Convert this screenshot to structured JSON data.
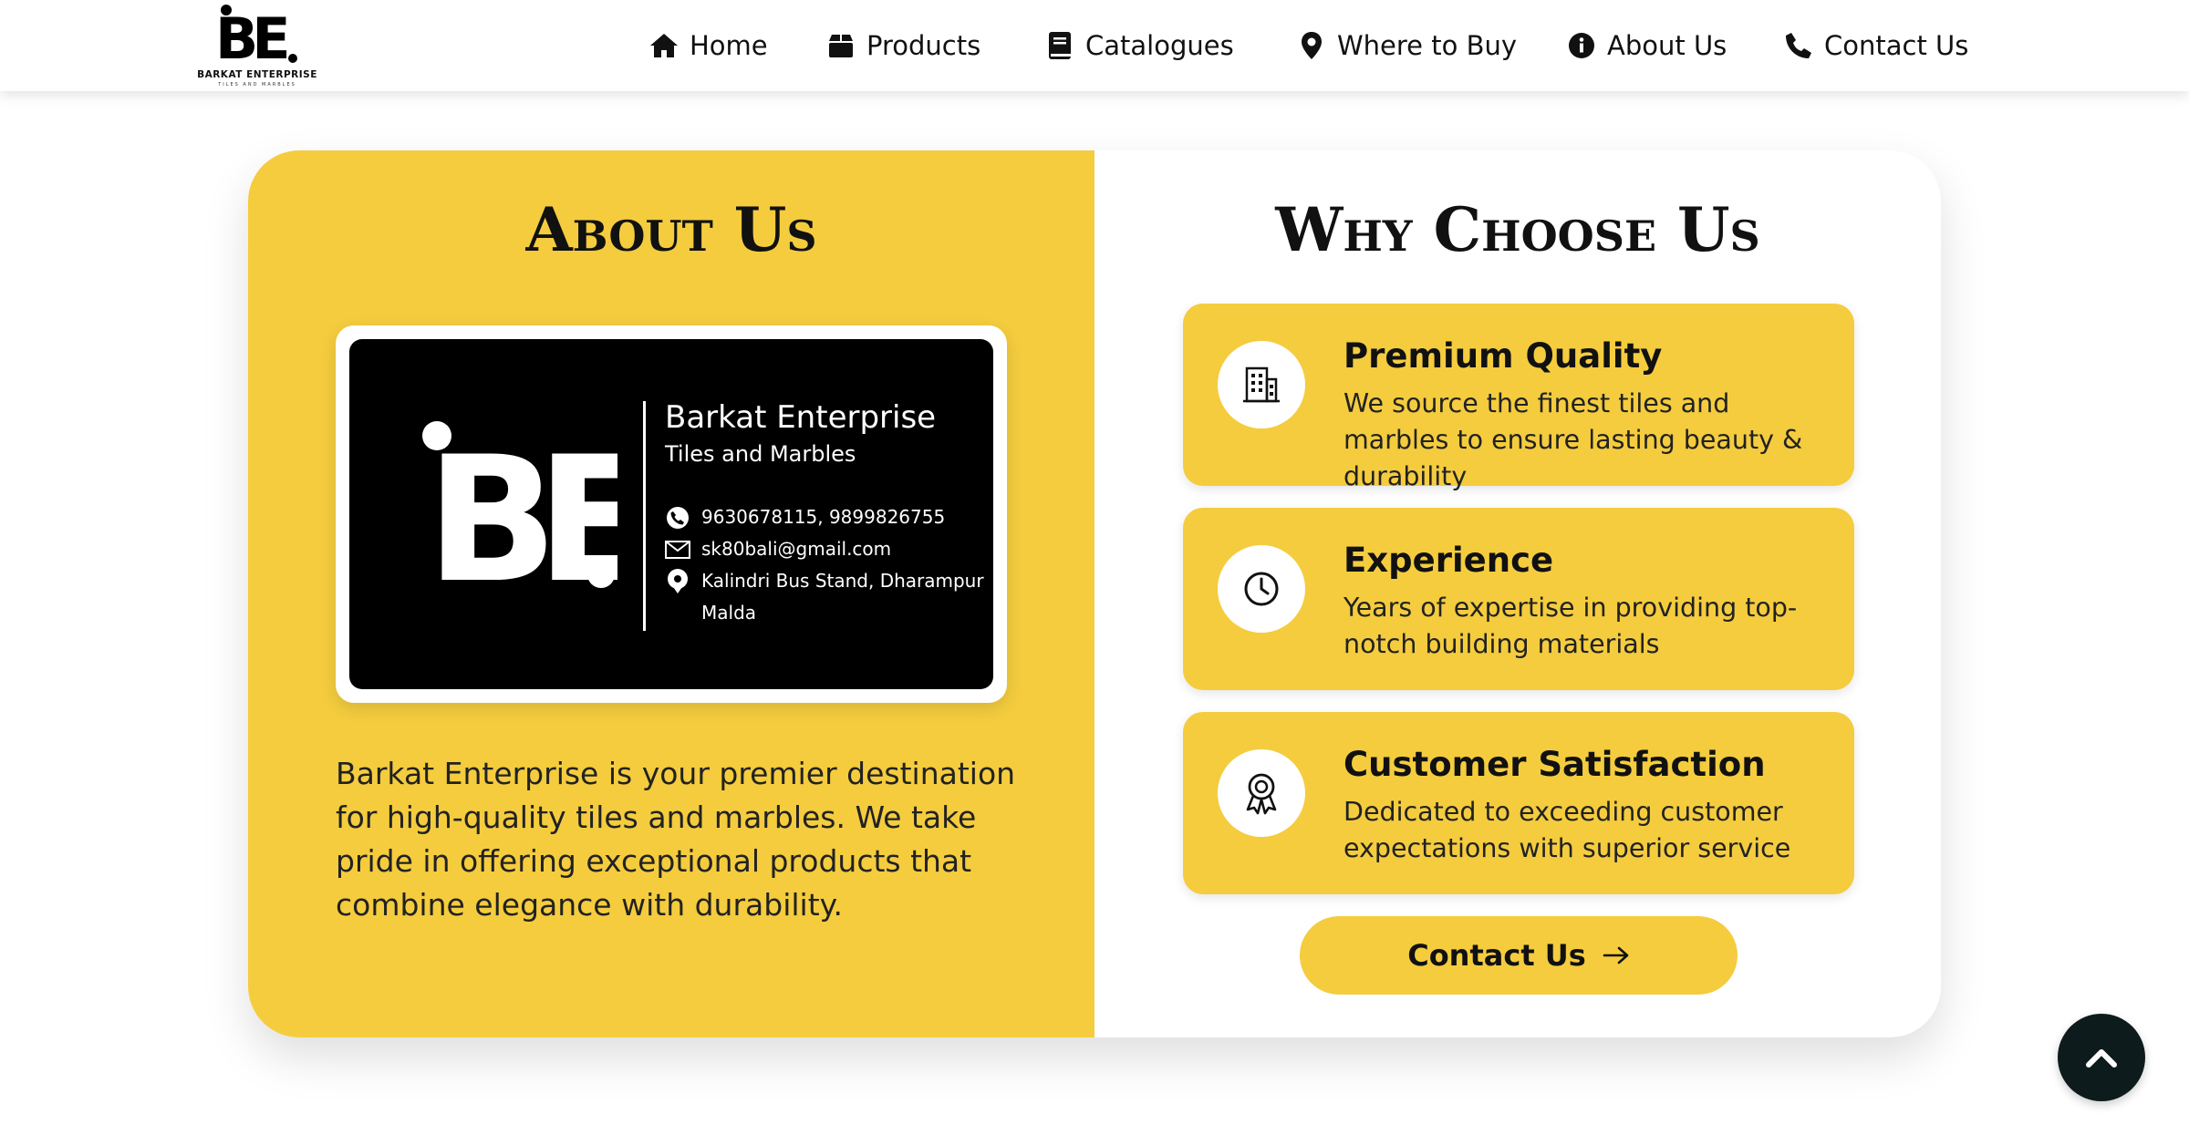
{
  "header": {
    "logo": {
      "mark": "BE",
      "name": "BARKAT ENTERPRISE",
      "sub": "TILES AND MARBLES"
    },
    "nav": [
      {
        "label": "Home",
        "icon": "home-icon"
      },
      {
        "label": "Products",
        "icon": "box-icon"
      },
      {
        "label": "Catalogues",
        "icon": "book-icon"
      },
      {
        "label": "Where to Buy",
        "icon": "location-pin-icon"
      },
      {
        "label": "About Us",
        "icon": "info-icon"
      },
      {
        "label": "Contact Us",
        "icon": "phone-icon"
      }
    ]
  },
  "about": {
    "title": "About Us",
    "business_card": {
      "name": "Barkat Enterprise",
      "tagline": "Tiles and Marbles",
      "phone": "9630678115, 9899826755",
      "email": "sk80bali@gmail.com",
      "address_line1": "Kalindri Bus Stand, Dharampur",
      "address_line2": "Malda"
    },
    "description": "Barkat Enterprise is your premier destination for high-quality tiles and marbles. We take pride in offering exceptional products that combine elegance with durability."
  },
  "why": {
    "title": "Why Choose Us",
    "features": [
      {
        "title": "Premium Quality",
        "description": "We source the finest tiles and marbles to ensure lasting beauty & durability",
        "icon": "building-icon"
      },
      {
        "title": "Experience",
        "description": "Years of expertise in providing top-notch building materials",
        "icon": "clock-icon"
      },
      {
        "title": "Customer Satisfaction",
        "description": "Dedicated to exceeding customer expectations with superior service",
        "icon": "award-icon"
      }
    ],
    "contact_button": "Contact Us"
  },
  "colors": {
    "accent": "#f4cc3e",
    "dark": "#0d1b1d",
    "card_black": "#000000"
  }
}
